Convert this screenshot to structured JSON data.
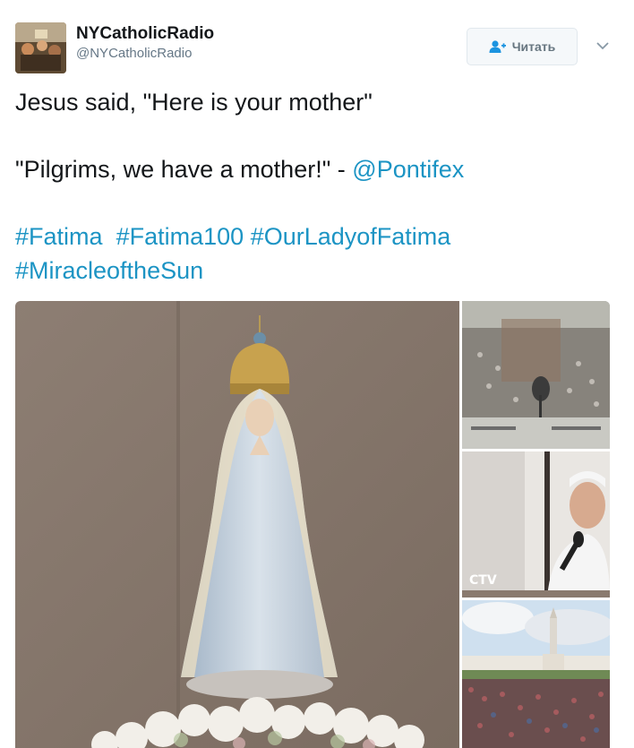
{
  "author": {
    "display_name": "NYCatholicRadio",
    "screen_name": "@NYCatholicRadio"
  },
  "follow_button": {
    "label": "Читать"
  },
  "tweet": {
    "line1": "Jesus said, \"Here is your mother\"",
    "line2_quote": "\"Pilgrims, we have a mother!\" - ",
    "mention": "@Pontifex",
    "hashtags_line1": [
      "#Fatima",
      "#Fatima100",
      "#OurLadyofFatima"
    ],
    "hashtags_line2": [
      "#MiracleoftheSun"
    ]
  },
  "media": {
    "watermark": "CTV"
  },
  "colors": {
    "link": "#1c94c4",
    "text": "#14171a",
    "muted": "#657786"
  },
  "icons": {
    "follow": "add-user-icon",
    "menu": "chevron-down-icon"
  }
}
